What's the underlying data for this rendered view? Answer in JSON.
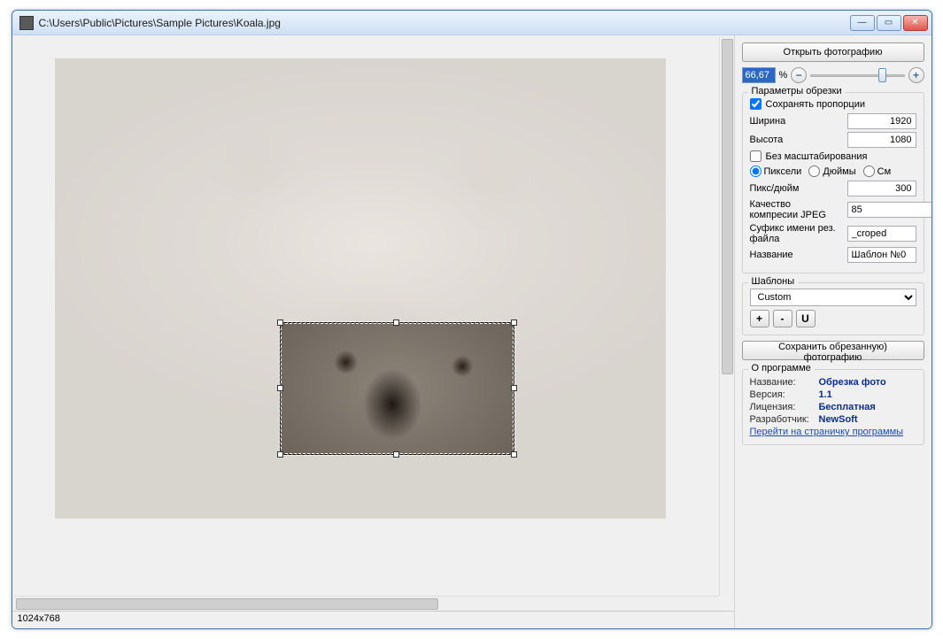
{
  "title": "C:\\Users\\Public\\Pictures\\Sample Pictures\\Koala.jpg",
  "status": "1024x768",
  "side": {
    "open_btn": "Открыть фотографию",
    "zoom_value": "66,67",
    "zoom_percent": "%",
    "crop_group": "Параметры обрезки",
    "keep_ratio": "Сохранять пропорции",
    "width_label": "Ширина",
    "width_value": "1920",
    "height_label": "Высота",
    "height_value": "1080",
    "no_scale": "Без масштабирования",
    "unit_px": "Пиксели",
    "unit_in": "Дюймы",
    "unit_cm": "См",
    "ppi_label": "Пикс/дюйм",
    "ppi_value": "300",
    "jpeg_label": "Качество компресии JPEG",
    "jpeg_value": "85",
    "suffix_label": "Суфикс имени рез. файла",
    "suffix_value": "_croped",
    "name_label": "Название",
    "name_value": "Шаблон №0",
    "templates_group": "Шаблоны",
    "template_selected": "Custom",
    "btn_add": "+",
    "btn_del": "-",
    "btn_u": "U",
    "save_btn": "Сохранить обрезанную) фотографию",
    "about_group": "О программе",
    "about_name_k": "Название:",
    "about_name_v": "Обрезка фото",
    "about_ver_k": "Версия:",
    "about_ver_v": "1.1",
    "about_lic_k": "Лицензия:",
    "about_lic_v": "Бесплатная",
    "about_dev_k": "Разработчик:",
    "about_dev_v": "NewSoft",
    "about_link": "Перейти на страничку программы"
  }
}
